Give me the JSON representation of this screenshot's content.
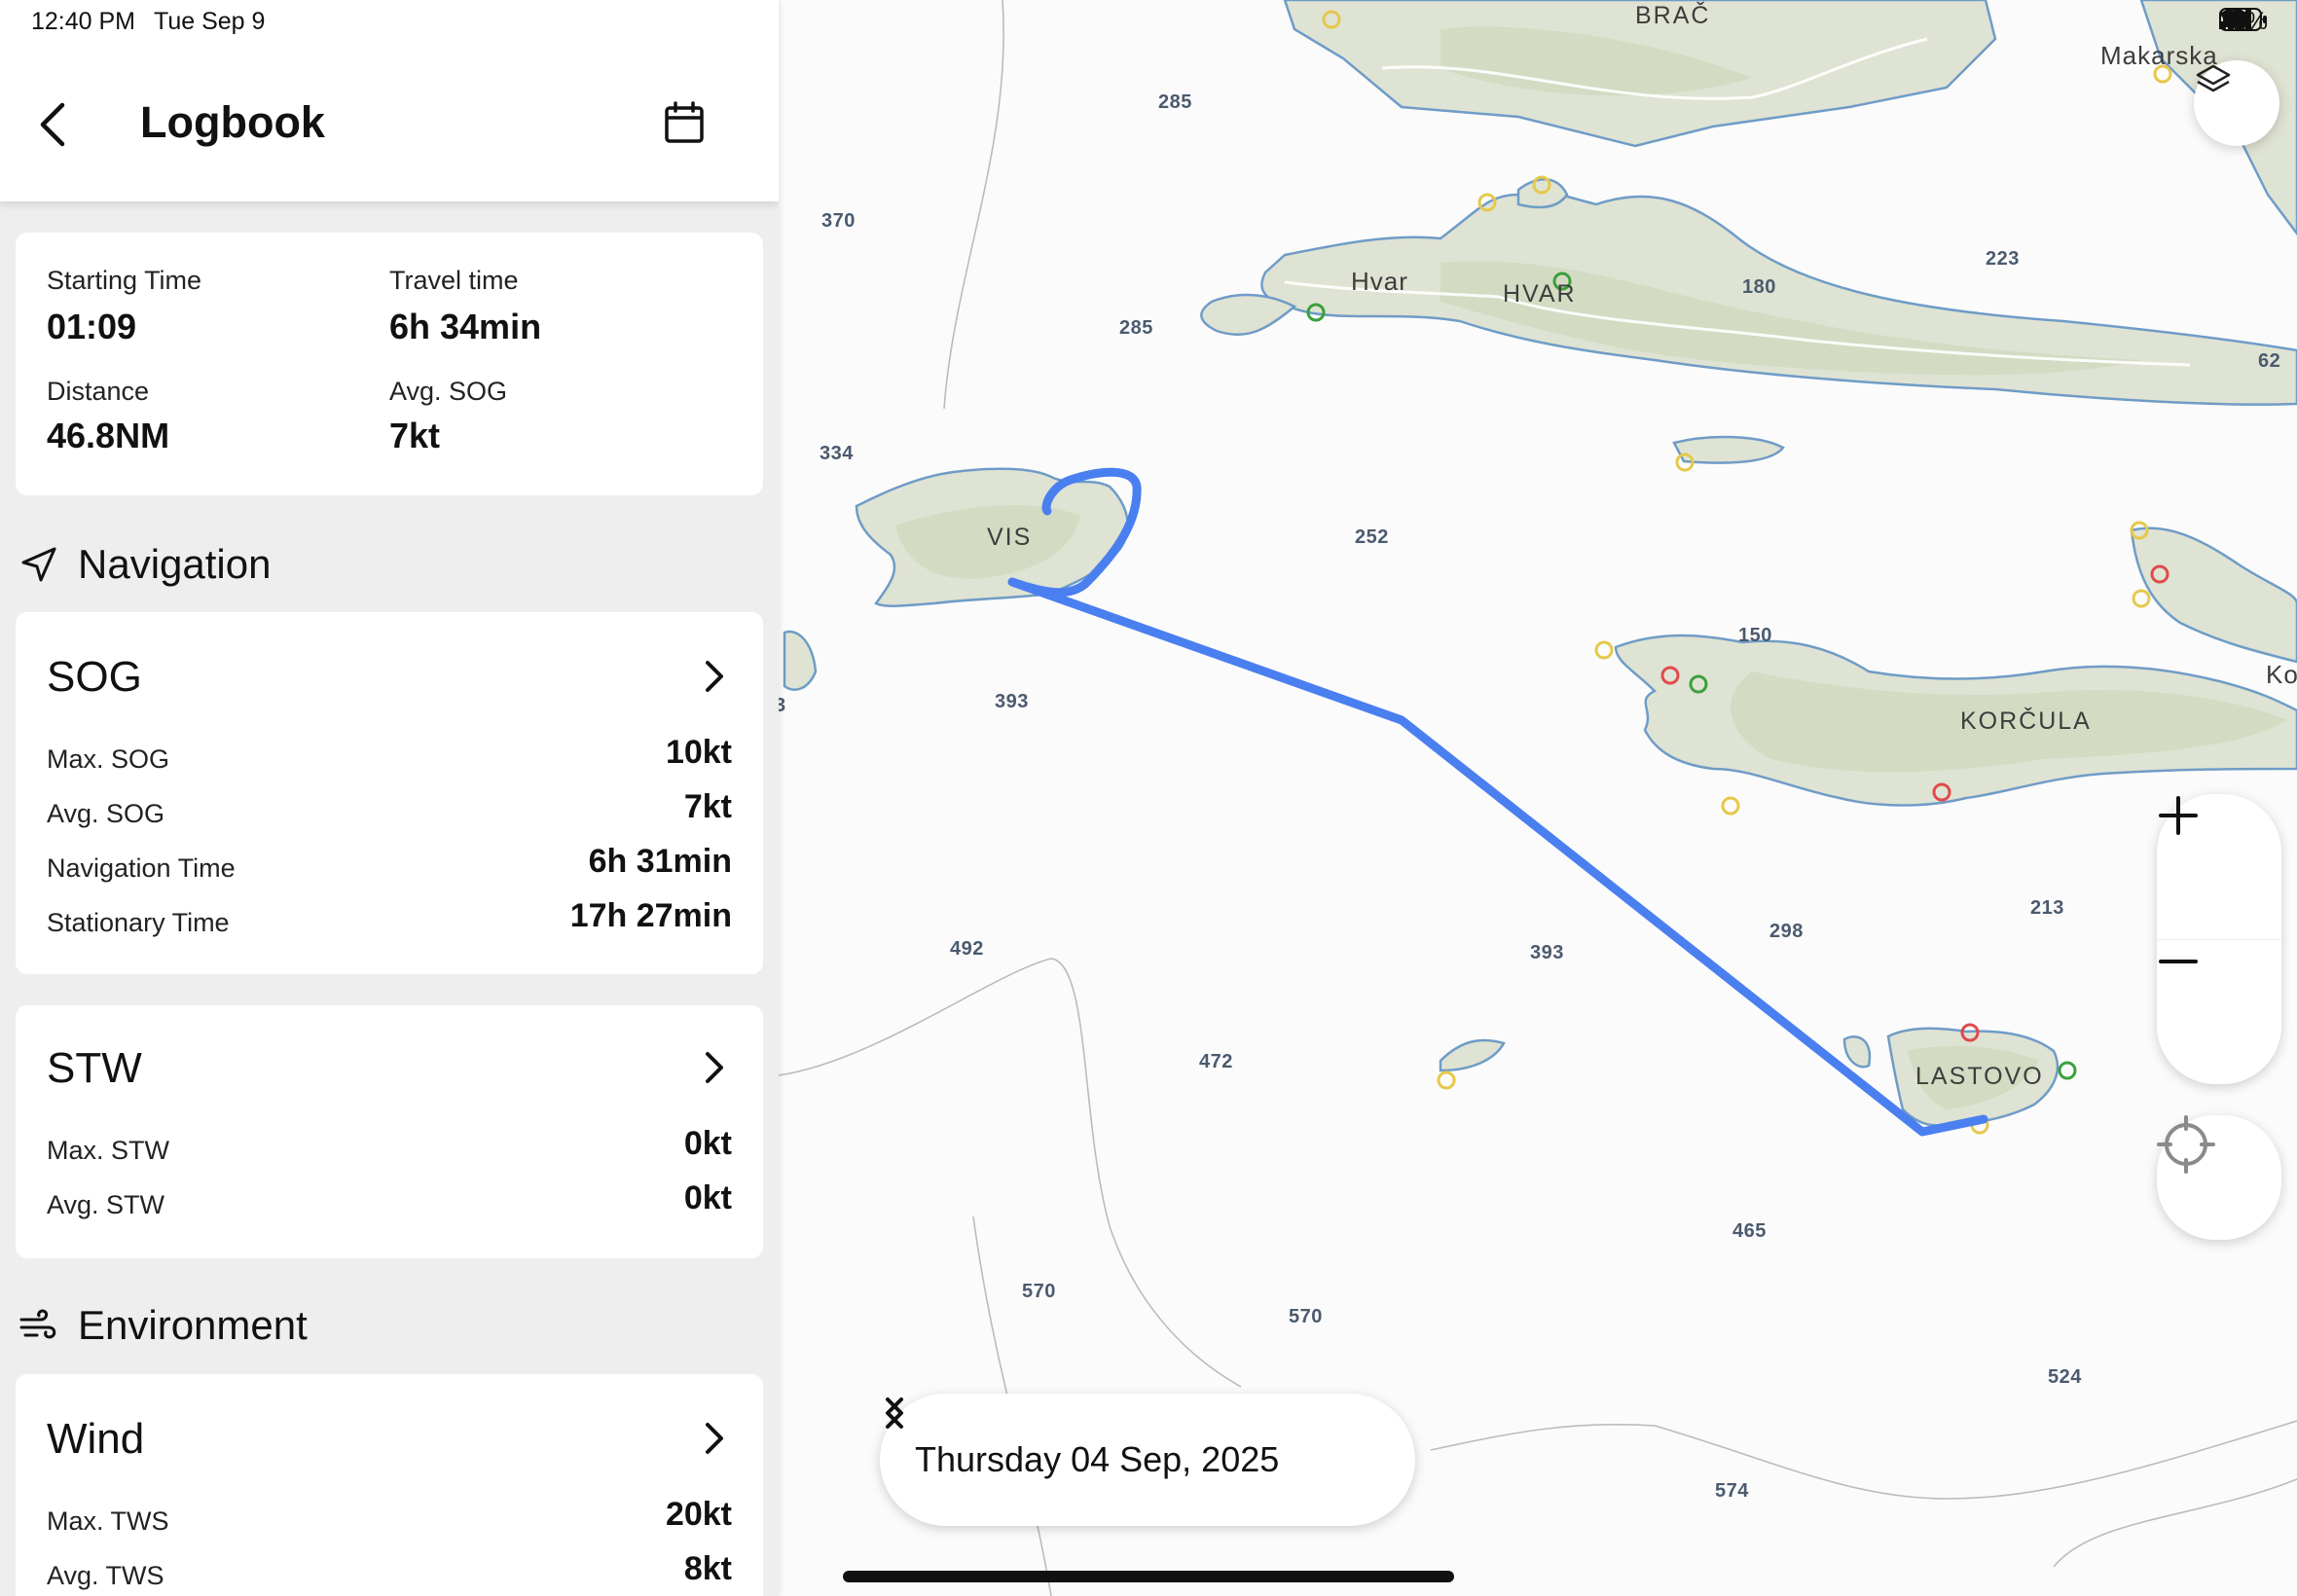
{
  "status_bar": {
    "time": "12:40 PM",
    "date": "Tue Sep 9",
    "battery": "71%",
    "icons": [
      "location-arrow-icon",
      "signal-icon",
      "wifi-icon",
      "battery-icon"
    ]
  },
  "header": {
    "title": "Logbook",
    "back_icon": "chevron-left-icon",
    "calendar_icon": "calendar-icon"
  },
  "summary": {
    "starting_time_label": "Starting Time",
    "starting_time_value": "01:09",
    "travel_time_label": "Travel time",
    "travel_time_value": "6h 34min",
    "distance_label": "Distance",
    "distance_value": "46.8NM",
    "avg_sog_label": "Avg. SOG",
    "avg_sog_value": "7kt"
  },
  "navigation": {
    "section_title": "Navigation",
    "icon": "navigation-arrow-icon",
    "sog": {
      "title": "SOG",
      "rows": [
        {
          "label": "Max. SOG",
          "value": "10kt"
        },
        {
          "label": "Avg. SOG",
          "value": "7kt"
        },
        {
          "label": "Navigation Time",
          "value": "6h 31min"
        },
        {
          "label": "Stationary Time",
          "value": "17h 27min"
        }
      ]
    },
    "stw": {
      "title": "STW",
      "rows": [
        {
          "label": "Max. STW",
          "value": "0kt"
        },
        {
          "label": "Avg. STW",
          "value": "0kt"
        }
      ]
    }
  },
  "environment": {
    "section_title": "Environment",
    "icon": "wind-icon",
    "wind": {
      "title": "Wind",
      "rows": [
        {
          "label": "Max. TWS",
          "value": "20kt"
        },
        {
          "label": "Avg. TWS",
          "value": "8kt"
        }
      ]
    }
  },
  "map": {
    "place_names": {
      "brac": "BRAČ",
      "makarska": "Makarska",
      "hvar_town": "Hvar",
      "hvar": "HVAR",
      "vis": "VIS",
      "korcula": "KORČULA",
      "lastovo": "LASTOVO",
      "ko": "Ko"
    },
    "depths": [
      "285",
      "370",
      "285",
      "334",
      "223",
      "180",
      "62",
      "252",
      "150",
      "393",
      "492",
      "393",
      "298",
      "213",
      "472",
      "465",
      "570",
      "570",
      "524",
      "574",
      "3"
    ],
    "route_color": "#4a7ff0",
    "date_label": "Thursday 04 Sep, 2025",
    "controls": {
      "layers_icon": "layers-icon",
      "zoom_in_icon": "plus-icon",
      "zoom_out_icon": "minus-icon",
      "locate_icon": "crosshair-icon",
      "prev_icon": "chevron-left-icon",
      "next_icon": "chevron-right-icon"
    }
  }
}
